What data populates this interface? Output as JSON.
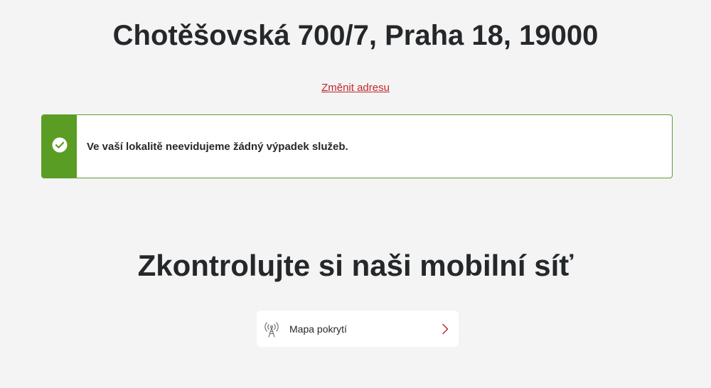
{
  "address": {
    "title": "Chotěšovská 700/7, Praha 18, 19000",
    "change_link_label": "Změnit adresu"
  },
  "status": {
    "message": "Ve vaší lokalitě neevidujeme žádný výpadek služeb.",
    "icon": "checkmark-circle-icon",
    "color": "#5a9d25"
  },
  "mobile_network": {
    "heading": "Zkontrolujte si naši mobilní síť",
    "coverage_card": {
      "label": "Mapa pokrytí",
      "icon": "antenna-icon",
      "arrow_icon": "chevron-right-icon"
    }
  },
  "colors": {
    "accent": "#c0282d",
    "success": "#5a9d25",
    "background": "#f4f4f4"
  }
}
